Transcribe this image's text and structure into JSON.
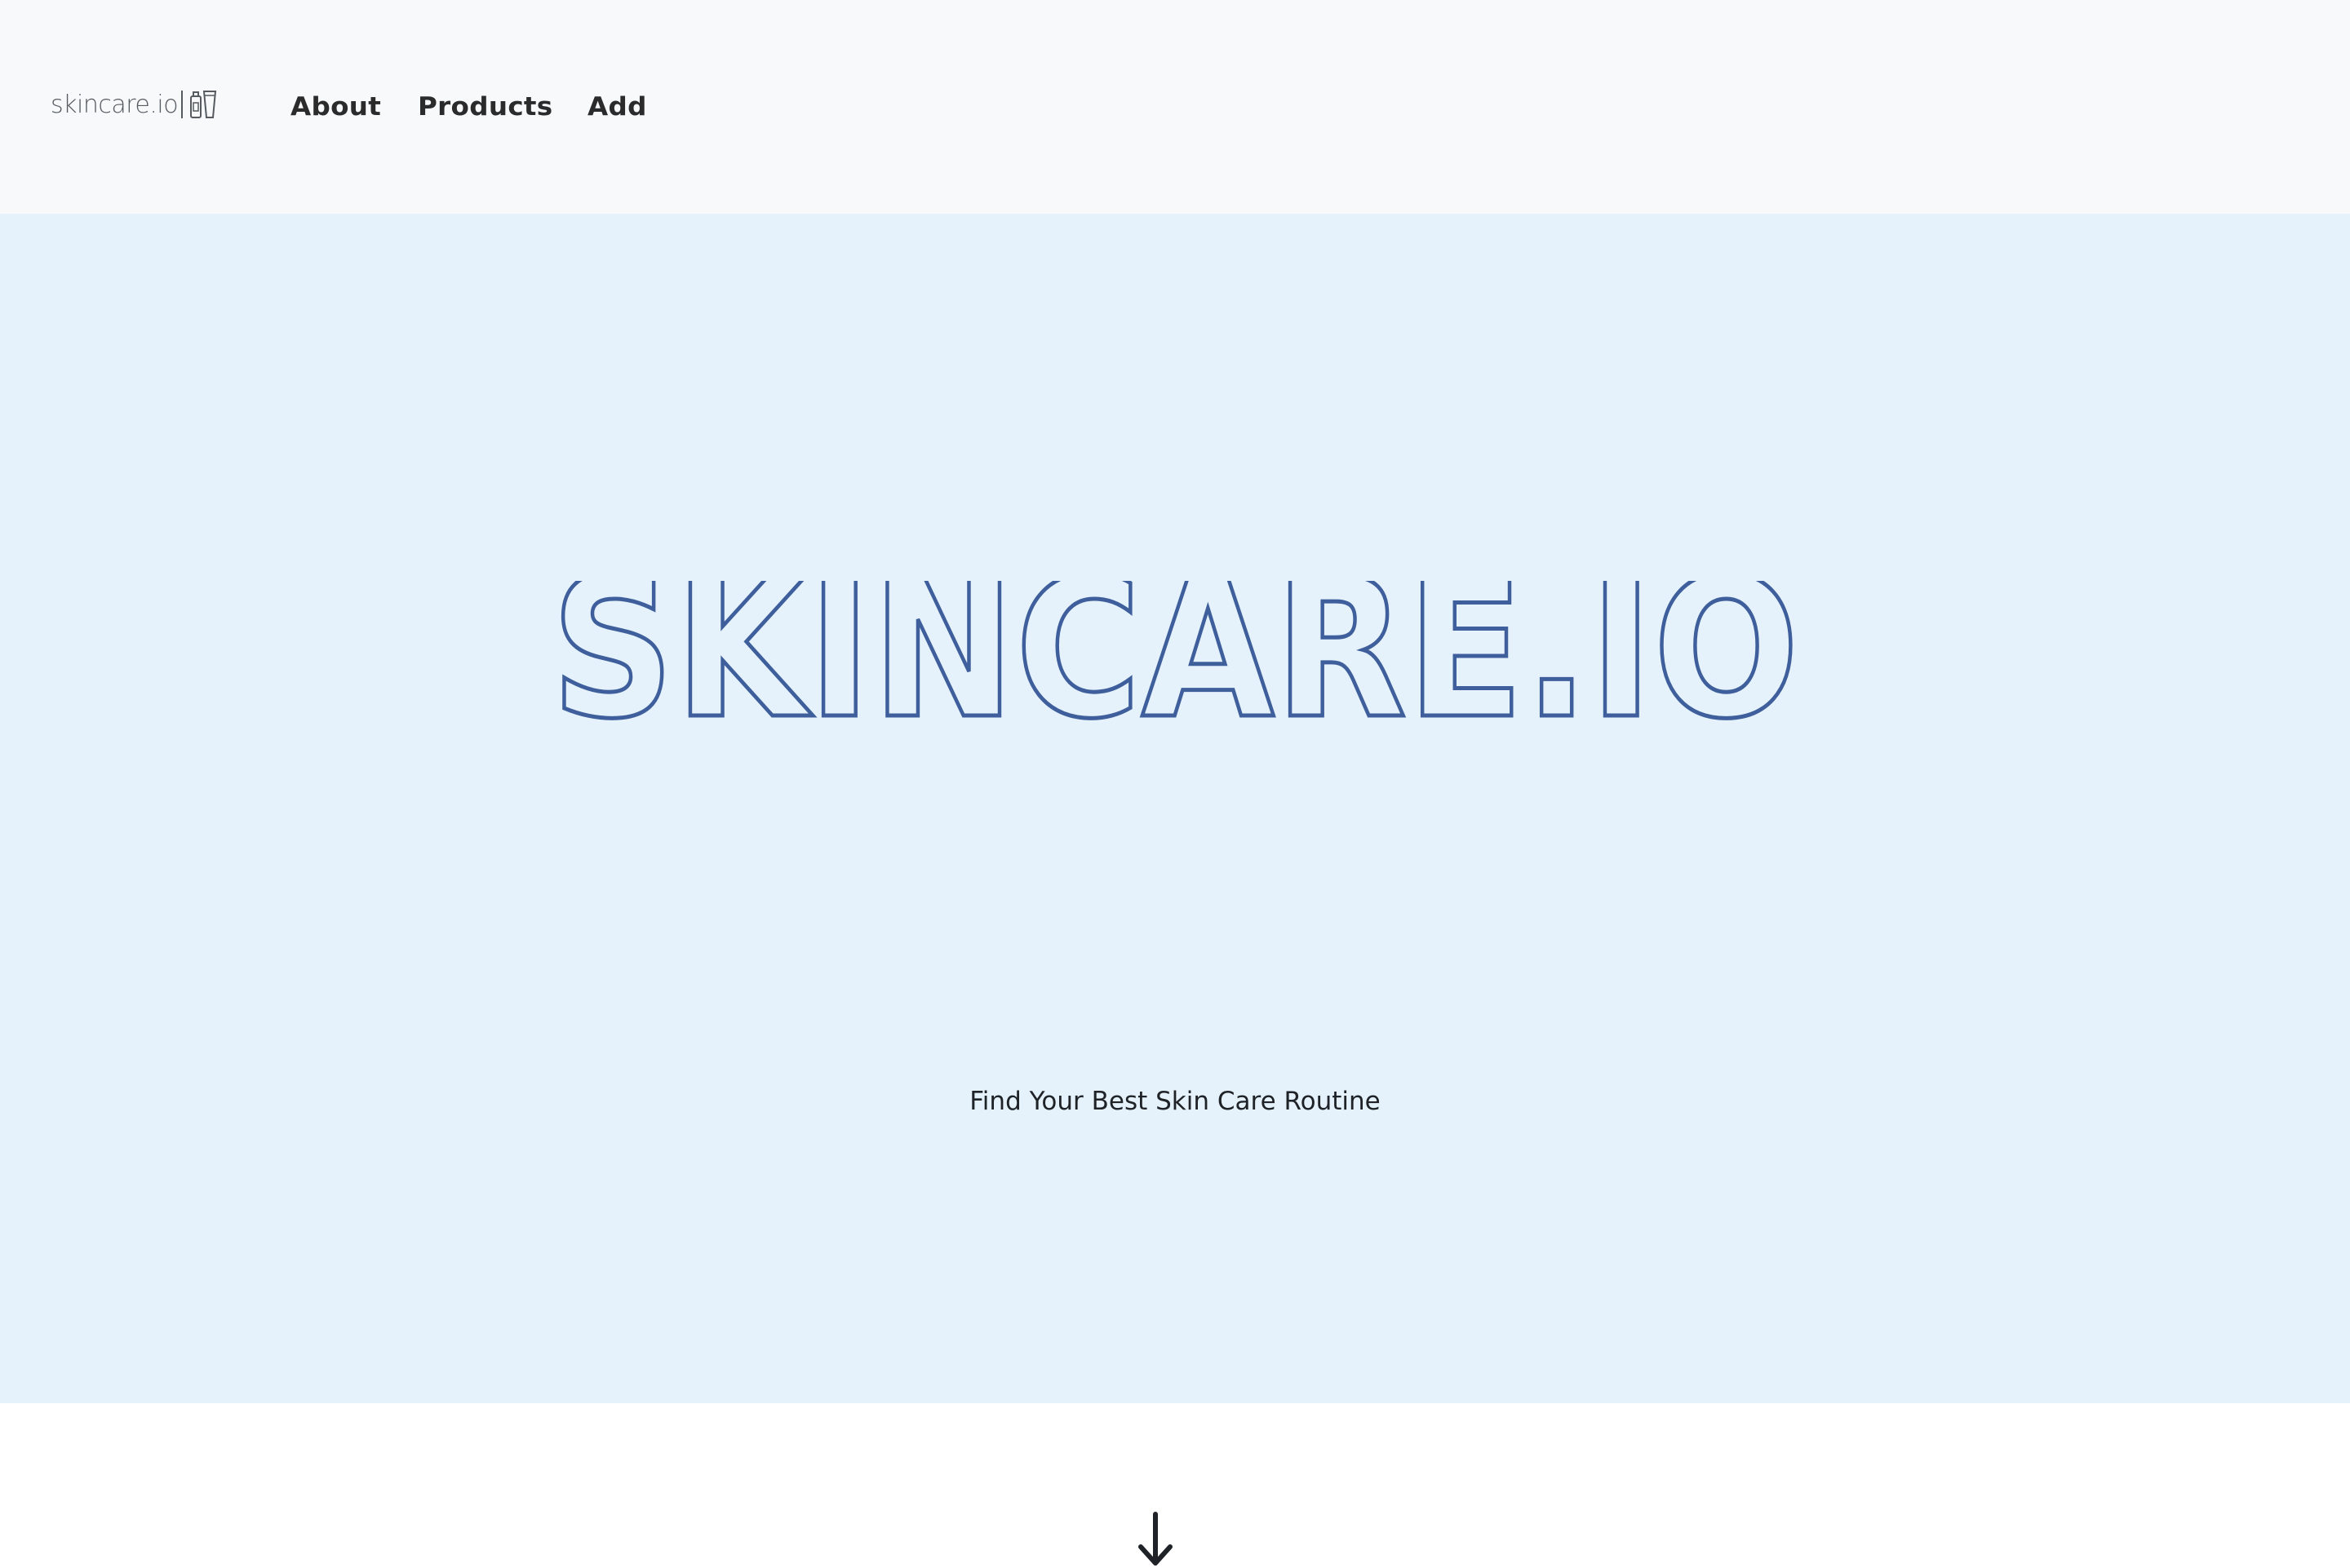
{
  "navbar": {
    "brand": "skincare.io",
    "brand_icon": "skincare-bottles-icon",
    "links": [
      {
        "label": "About"
      },
      {
        "label": "Products"
      },
      {
        "label": "Add"
      }
    ],
    "background": "#f7f9fb"
  },
  "hero": {
    "title": "SKINCARE.IO",
    "subtitle": "Find Your Best Skin Care Routine",
    "scroll_icon": "arrow-down-icon",
    "background": "#e5f2fb",
    "title_outline_color": "#3e5f9c"
  }
}
